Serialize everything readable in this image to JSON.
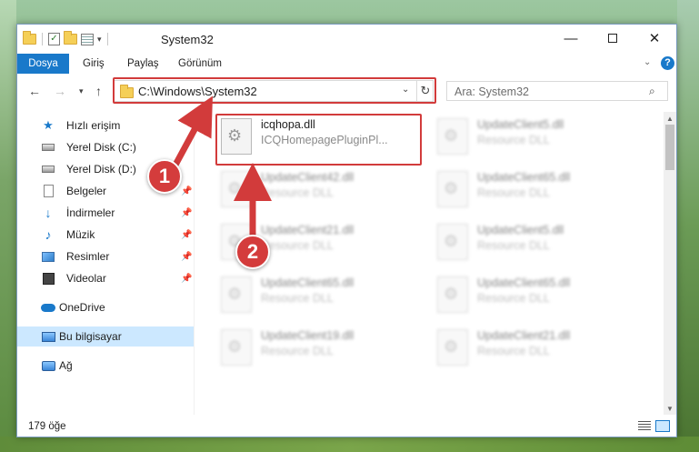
{
  "window": {
    "title": "System32"
  },
  "ribbon": {
    "tabs": [
      "Dosya",
      "Giriş",
      "Paylaş",
      "Görünüm"
    ]
  },
  "address_bar": {
    "path": "C:\\Windows\\System32"
  },
  "search": {
    "placeholder": "Ara: System32"
  },
  "sidebar": {
    "items": [
      {
        "label": "Hızlı erişim",
        "icon": "star-icon"
      },
      {
        "label": "Yerel Disk (C:)",
        "icon": "drive-icon"
      },
      {
        "label": "Yerel Disk (D:)",
        "icon": "drive-icon"
      },
      {
        "label": "Belgeler",
        "icon": "document-icon",
        "pinned": true
      },
      {
        "label": "İndirmeler",
        "icon": "download-icon",
        "pinned": true
      },
      {
        "label": "Müzik",
        "icon": "music-icon",
        "pinned": true
      },
      {
        "label": "Resimler",
        "icon": "pictures-icon",
        "pinned": true
      },
      {
        "label": "Videolar",
        "icon": "videos-icon",
        "pinned": true
      },
      {
        "label": "OneDrive",
        "icon": "onedrive-icon"
      },
      {
        "label": "Bu bilgisayar",
        "icon": "computer-icon",
        "selected": true
      },
      {
        "label": "Ağ",
        "icon": "network-icon"
      }
    ]
  },
  "files": [
    {
      "name": "icqhopa.dll",
      "desc": "ICQHomepagePluginPl...",
      "highlighted": true
    },
    {
      "name": "UpdateClient5.dll",
      "desc": "Resource DLL"
    },
    {
      "name": "UpdateClient42.dll",
      "desc": "Resource DLL"
    },
    {
      "name": "UpdateClient65.dll",
      "desc": "Resource DLL"
    },
    {
      "name": "UpdateClient21.dll",
      "desc": "Resource DLL"
    },
    {
      "name": "UpdateClient5.dll",
      "desc": "Resource DLL"
    },
    {
      "name": "UpdateClient65.dll",
      "desc": "Resource DLL"
    },
    {
      "name": "UpdateClient65.dll",
      "desc": "Resource DLL"
    },
    {
      "name": "UpdateClient19.dll",
      "desc": "Resource DLL"
    },
    {
      "name": "UpdateClient21.dll",
      "desc": "Resource DLL"
    }
  ],
  "status": {
    "count": "179 öğe"
  },
  "annotations": {
    "step1": "1",
    "step2": "2",
    "color": "#d23b3b"
  }
}
